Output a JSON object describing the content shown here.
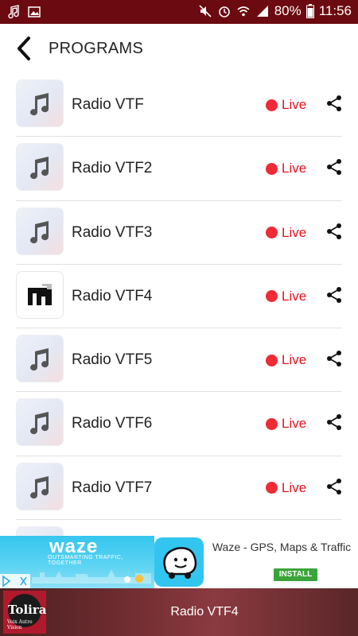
{
  "status_bar": {
    "battery": "80%",
    "time": "11:56",
    "left_icons": [
      "music-note-icon",
      "image-icon"
    ],
    "right_icons": [
      "mute-icon",
      "alarm-icon",
      "wifi-icon",
      "signal-icon",
      "battery-icon"
    ]
  },
  "header": {
    "title": "PROGRAMS",
    "back_icon": "chevron-left-icon"
  },
  "programs": [
    {
      "name": "Radio VTF",
      "status": "Live",
      "thumb": "music-note-icon"
    },
    {
      "name": "Radio VTF2",
      "status": "Live",
      "thumb": "music-note-icon"
    },
    {
      "name": "Radio VTF3",
      "status": "Live",
      "thumb": "music-note-icon"
    },
    {
      "name": "Radio VTF4",
      "status": "Live",
      "thumb": "station-logo-icon"
    },
    {
      "name": "Radio VTF5",
      "status": "Live",
      "thumb": "music-note-icon"
    },
    {
      "name": "Radio VTF6",
      "status": "Live",
      "thumb": "music-note-icon"
    },
    {
      "name": "Radio VTF7",
      "status": "Live",
      "thumb": "music-note-icon"
    }
  ],
  "ad": {
    "brand": "waze",
    "tagline": "OUTSMARTING TRAFFIC, TOGETHER",
    "title": "Waze - GPS, Maps & Traffic",
    "install": "INSTALL"
  },
  "player": {
    "now_playing": "Radio VTF4",
    "art_text": "Tolira",
    "art_sub": "Voix Autre Vision"
  },
  "colors": {
    "status_bar": "#6b0a10",
    "live_red": "#e8121f",
    "install_green": "#3aa43a"
  }
}
